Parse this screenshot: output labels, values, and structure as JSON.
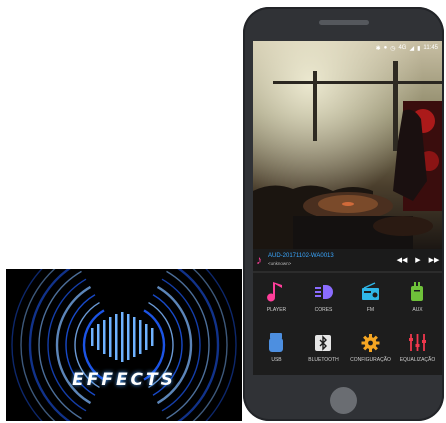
{
  "promo": {
    "text": "EFFECTS"
  },
  "status_bar": {
    "network": "4G",
    "time": "11:45"
  },
  "now_playing": {
    "title": "AUD-20171102-WA0013",
    "artist": "<unknown>",
    "prev_icon": "rewind-icon",
    "play_icon": "play-icon",
    "next_icon": "fast-forward-icon"
  },
  "menu": [
    {
      "label": "PLAYER",
      "icon": "music-note-icon",
      "color": "#ff3e9a"
    },
    {
      "label": "CORES",
      "icon": "headlight-icon",
      "color": "#8b6cff"
    },
    {
      "label": "FM",
      "icon": "radio-icon",
      "color": "#2fb7e8"
    },
    {
      "label": "AUX",
      "icon": "aux-cable-icon",
      "color": "#6fc23a"
    },
    {
      "label": "USB",
      "icon": "usb-icon",
      "color": "#4d8fe0"
    },
    {
      "label": "BLUETOOTH",
      "icon": "bluetooth-icon",
      "color": "#e6e6e6"
    },
    {
      "label": "CONFIGURAÇÃO",
      "icon": "gear-icon",
      "color": "#f5a623"
    },
    {
      "label": "EQUALIZAÇÃO",
      "icon": "equalizer-icon",
      "color": "#f0384d"
    }
  ],
  "colors": {
    "accent_blue": "#3aa7ff",
    "effects_glow": "#1f5dff"
  }
}
